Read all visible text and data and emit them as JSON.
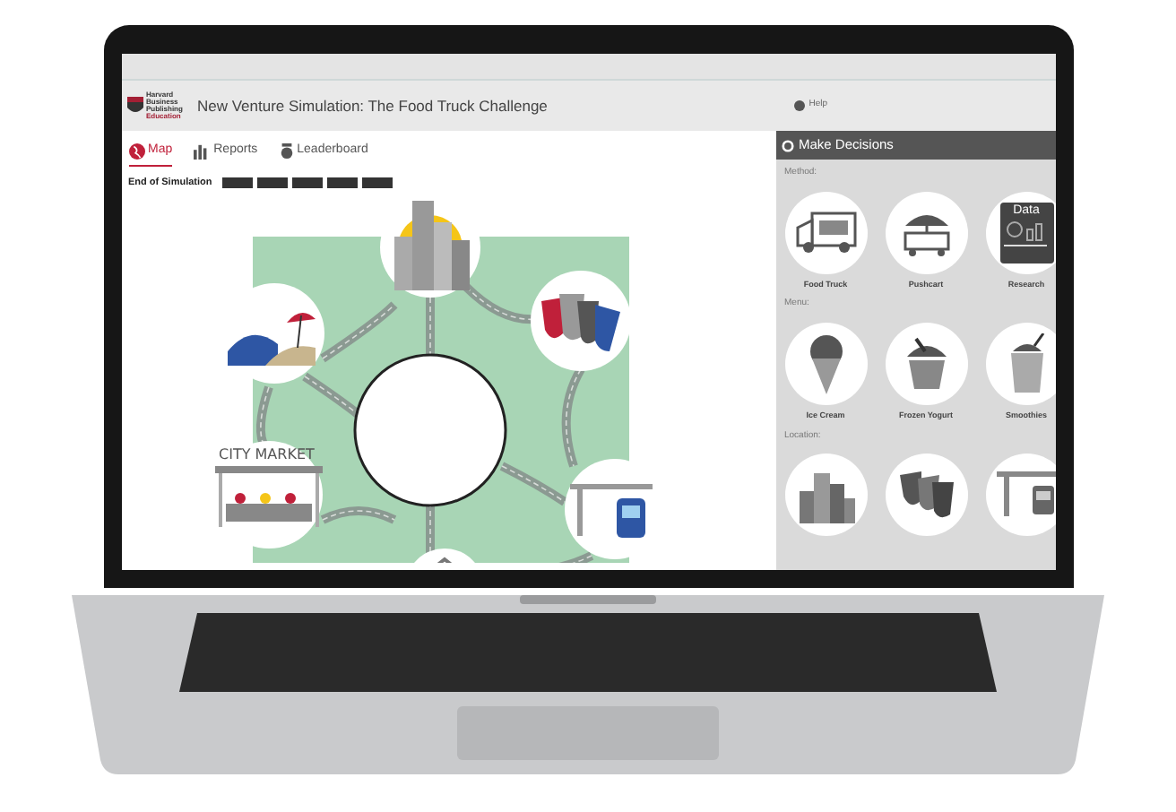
{
  "header": {
    "logo_lines": [
      "Harvard",
      "Business",
      "Publishing",
      "Education"
    ],
    "title": "New Venture Simulation: The Food Truck Challenge",
    "help": "Help"
  },
  "tabs": [
    {
      "label": "Map",
      "kind": "map",
      "selected": true
    },
    {
      "label": "Reports",
      "kind": "reports",
      "selected": false
    },
    {
      "label": "Leaderboard",
      "kind": "leaderboard",
      "selected": false
    }
  ],
  "status": {
    "label": "End of Simulation"
  },
  "map": {
    "spots": [
      {
        "kind": "city"
      },
      {
        "kind": "beach"
      },
      {
        "kind": "theater"
      },
      {
        "kind": "market",
        "label": "CITY MARKET"
      },
      {
        "kind": "station"
      },
      {
        "kind": "bottom"
      }
    ]
  },
  "decisions": {
    "title": "Make Decisions",
    "sections": [
      {
        "label": "Method:",
        "items": [
          {
            "kind": "truck",
            "label": "Food Truck"
          },
          {
            "kind": "cart",
            "label": "Pushcart"
          },
          {
            "kind": "data",
            "label": "Research",
            "badge": "Data"
          }
        ]
      },
      {
        "label": "Menu:",
        "items": [
          {
            "kind": "icecream",
            "label": "Ice Cream"
          },
          {
            "kind": "yogurt",
            "label": "Frozen Yogurt"
          },
          {
            "kind": "smoothie",
            "label": "Smoothies"
          }
        ]
      },
      {
        "label": "Location:",
        "items": [
          {
            "kind": "city"
          },
          {
            "kind": "theater"
          },
          {
            "kind": "station"
          }
        ]
      }
    ]
  }
}
